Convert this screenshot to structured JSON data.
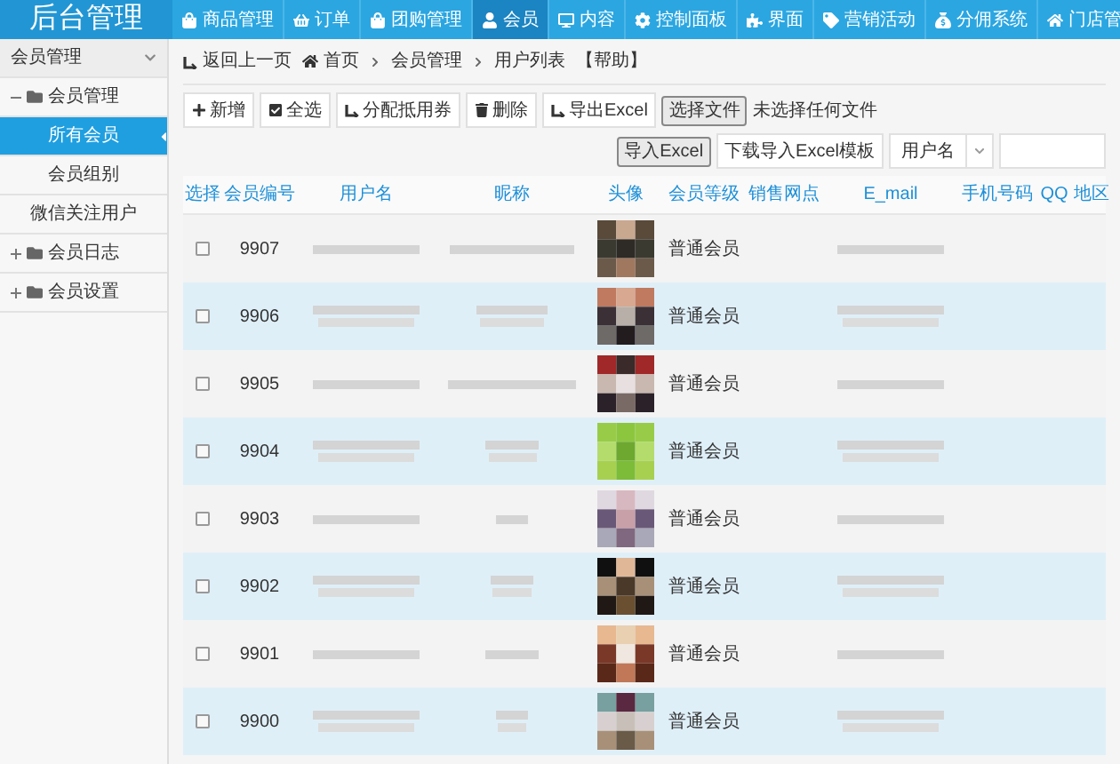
{
  "logo": "后台管理",
  "nav": [
    {
      "label": "商品管理",
      "selected": false
    },
    {
      "label": "订单",
      "selected": false
    },
    {
      "label": "团购管理",
      "selected": false
    },
    {
      "label": "会员",
      "selected": true
    },
    {
      "label": "内容",
      "selected": false
    },
    {
      "label": "控制面板",
      "selected": false
    },
    {
      "label": "界面",
      "selected": false
    },
    {
      "label": "营销活动",
      "selected": false
    },
    {
      "label": "分佣系统",
      "selected": false
    },
    {
      "label": "门店管",
      "selected": false
    }
  ],
  "sidebar": {
    "header": "会员管理",
    "tree": [
      {
        "label": "会员管理",
        "expanded": true,
        "children": [
          {
            "label": "所有会员",
            "selected": true
          },
          {
            "label": "会员组别",
            "selected": false
          },
          {
            "label": "微信关注用户",
            "selected": false
          }
        ]
      },
      {
        "label": "会员日志",
        "expanded": false
      },
      {
        "label": "会员设置",
        "expanded": false
      }
    ]
  },
  "breadcrumb": {
    "back": "返回上一页",
    "crumbs": [
      "首页",
      "会员管理",
      "用户列表"
    ],
    "help": "【帮助】"
  },
  "toolbar": {
    "buttons": [
      "新增",
      "全选",
      "分配抵用券",
      "删除",
      "导出Excel"
    ],
    "file_button": "选择文件",
    "file_status": "未选择任何文件",
    "import_button": "导入Excel",
    "template_link": "下载导入Excel模板",
    "search_select": "用户名"
  },
  "table": {
    "columns": [
      "选择",
      "会员编号",
      "用户名",
      "昵称",
      "头像",
      "会员等级",
      "销售网点",
      "E_mail",
      "手机号码",
      "QQ",
      "地区"
    ],
    "rows": [
      {
        "id": "9907",
        "level": "普通会员",
        "checked": false
      },
      {
        "id": "9906",
        "level": "普通会员",
        "checked": false
      },
      {
        "id": "9905",
        "level": "普通会员",
        "checked": false
      },
      {
        "id": "9904",
        "level": "普通会员",
        "checked": false
      },
      {
        "id": "9903",
        "level": "普通会员",
        "checked": false
      },
      {
        "id": "9902",
        "level": "普通会员",
        "checked": false
      },
      {
        "id": "9901",
        "level": "普通会员",
        "checked": false
      },
      {
        "id": "9900",
        "level": "普通会员",
        "checked": false
      }
    ]
  }
}
